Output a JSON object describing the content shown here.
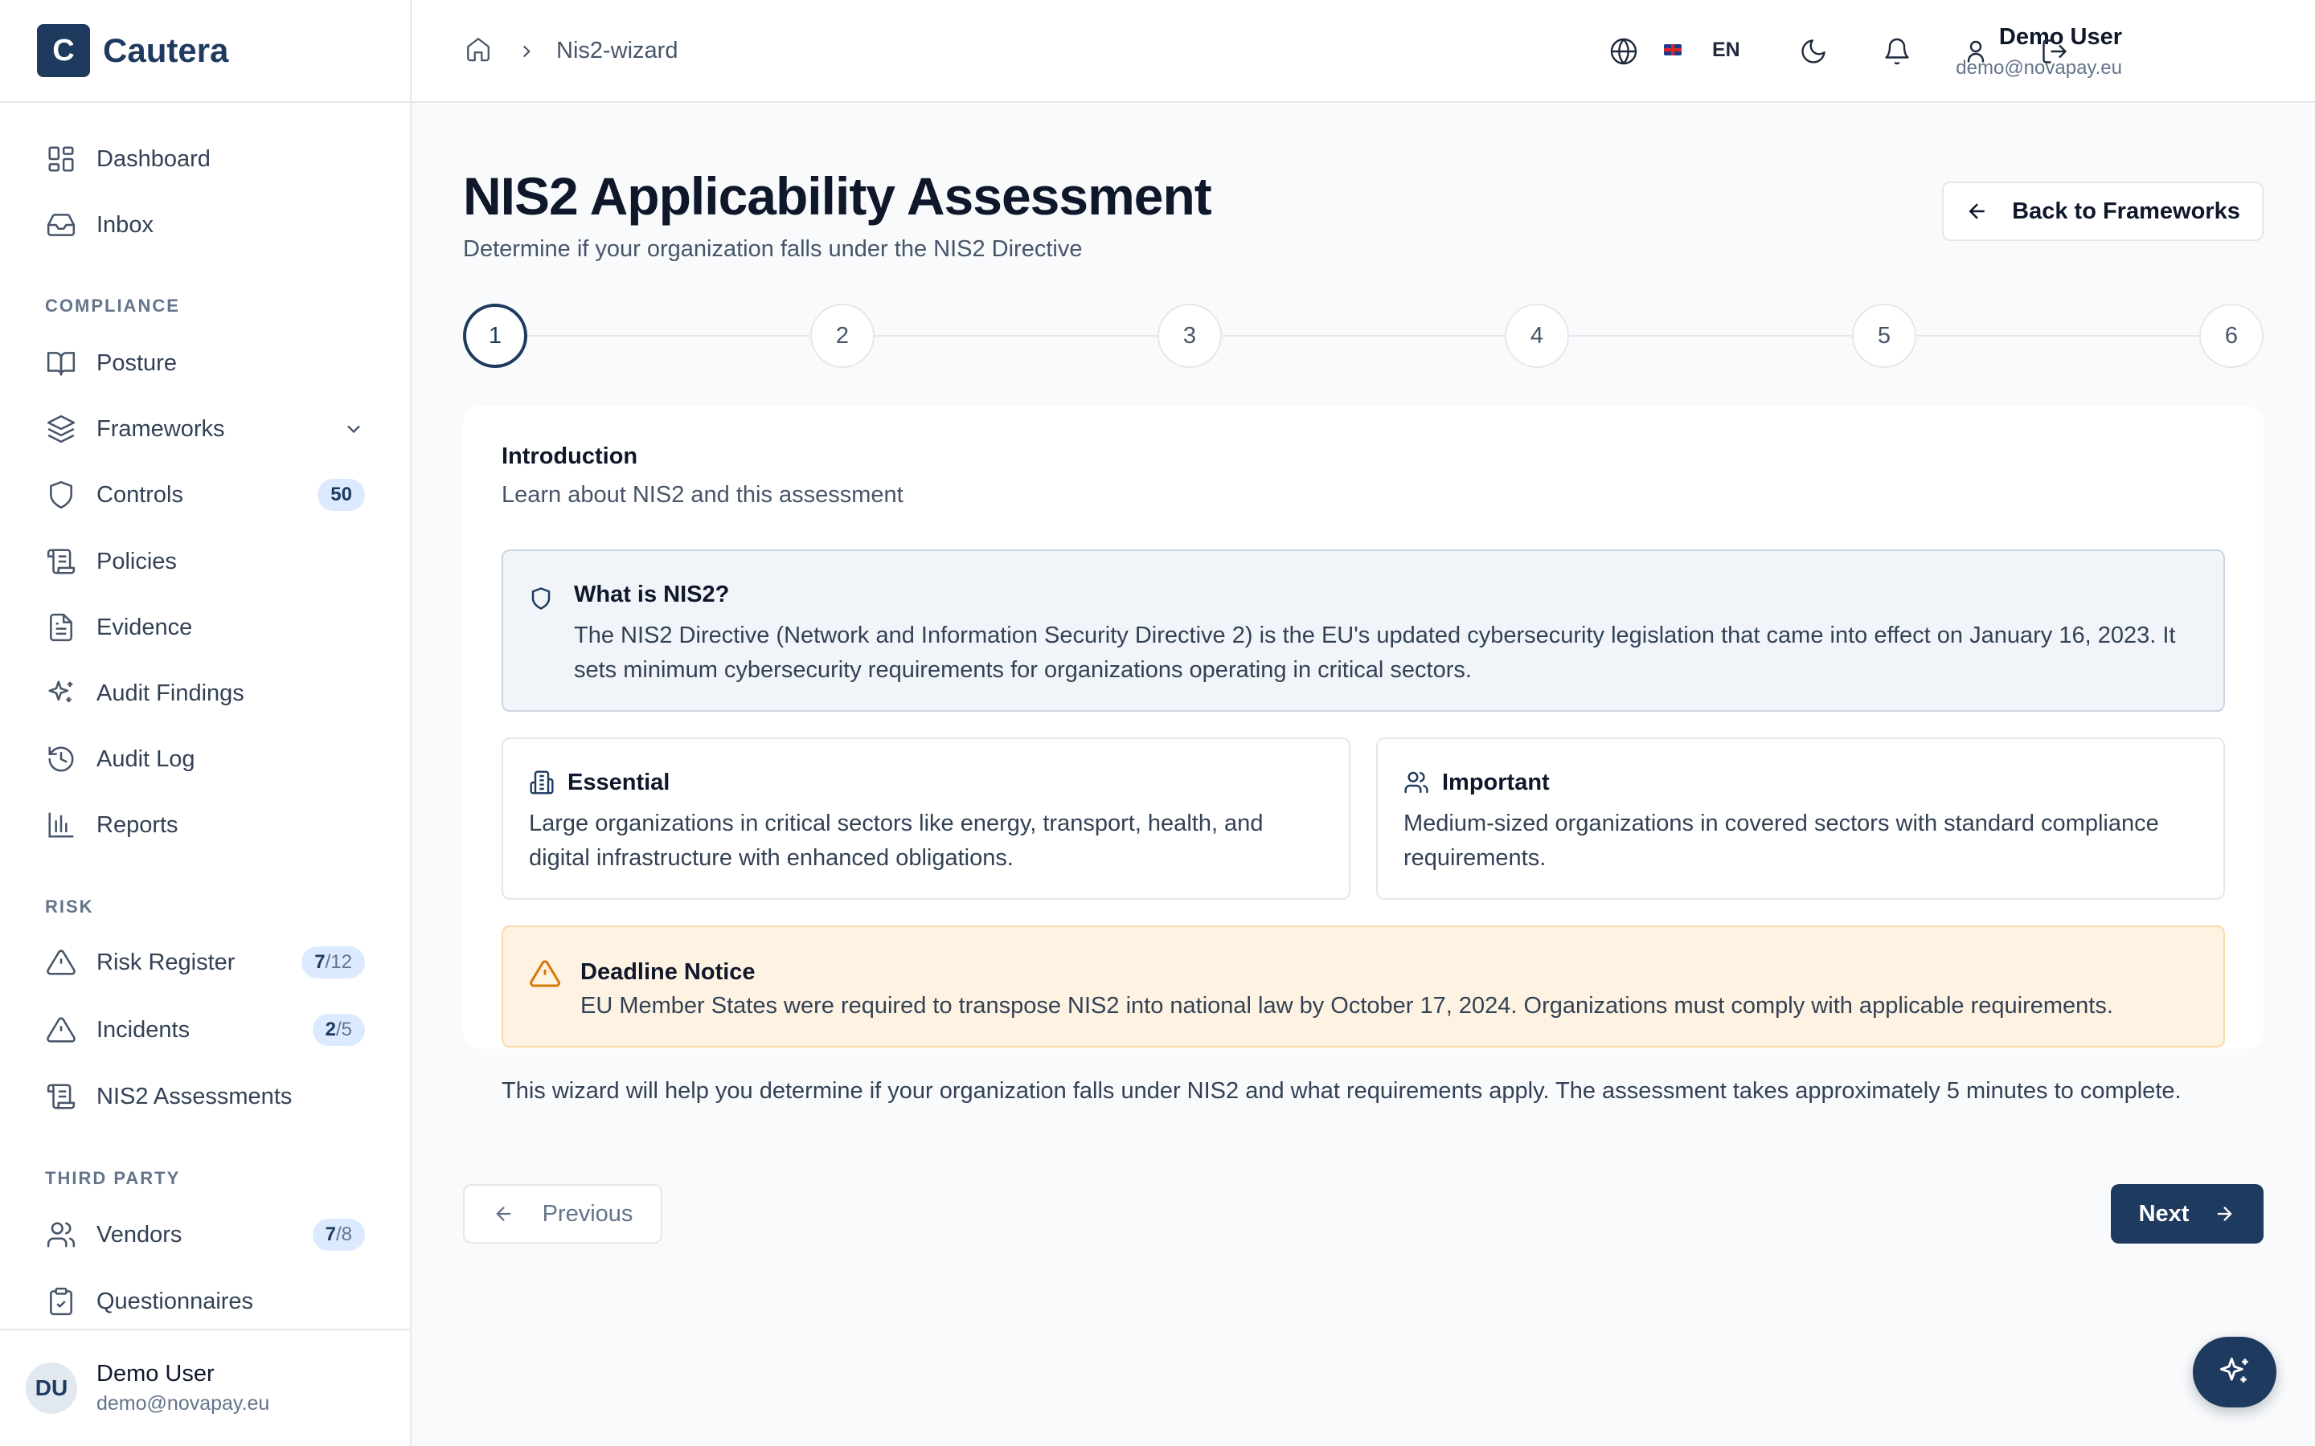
{
  "brand": {
    "logo_letter": "C",
    "name": "Cautera"
  },
  "sidebar": {
    "items": [
      {
        "label": "Dashboard",
        "icon": "grid-icon"
      },
      {
        "label": "Inbox",
        "icon": "inbox-icon"
      }
    ],
    "compliance_title": "COMPLIANCE",
    "compliance": [
      {
        "label": "Posture",
        "icon": "book-open-icon"
      },
      {
        "label": "Frameworks",
        "icon": "layers-icon"
      },
      {
        "label": "Controls",
        "icon": "shield-icon",
        "badge": "50"
      },
      {
        "label": "Policies",
        "icon": "scroll-icon"
      },
      {
        "label": "Evidence",
        "icon": "file-text-icon"
      },
      {
        "label": "Audit Findings",
        "icon": "sparkles-icon"
      },
      {
        "label": "Audit Log",
        "icon": "history-icon"
      },
      {
        "label": "Reports",
        "icon": "bar-chart-icon"
      }
    ],
    "risk_title": "RISK",
    "risk": [
      {
        "label": "Risk Register",
        "icon": "alert-triangle-icon",
        "badge_a": "7",
        "badge_b": "/12"
      },
      {
        "label": "Incidents",
        "icon": "alert-triangle-icon",
        "badge_a": "2",
        "badge_b": "/5"
      },
      {
        "label": "NIS2 Assessments",
        "icon": "scroll-icon"
      }
    ],
    "third_party_title": "THIRD PARTY",
    "third_party": [
      {
        "label": "Vendors",
        "icon": "users-icon",
        "badge_a": "7",
        "badge_b": "/8"
      },
      {
        "label": "Questionnaires",
        "icon": "clipboard-check-icon"
      }
    ],
    "user": {
      "initials": "DU",
      "name": "Demo User",
      "email": "demo@novapay.eu"
    }
  },
  "topbar": {
    "breadcrumb": "Nis2-wizard",
    "language": "EN",
    "user_name": "Demo User",
    "user_email": "demo@novapay.eu"
  },
  "page": {
    "title": "NIS2 Applicability Assessment",
    "subtitle": "Determine if your organization falls under the NIS2 Directive",
    "back_label": "Back to Frameworks"
  },
  "steps": [
    "1",
    "2",
    "3",
    "4",
    "5",
    "6"
  ],
  "current_step": 1,
  "card": {
    "title": "Introduction",
    "subtitle": "Learn about NIS2 and this assessment",
    "info_title": "What is NIS2?",
    "info_text": "The NIS2 Directive (Network and Information Security Directive 2) is the EU's updated cybersecurity legislation that came into effect on January 16, 2023. It sets minimum cybersecurity requirements for organizations operating in critical sectors.",
    "essential_title": "Essential",
    "essential_text": "Large organizations in critical sectors like energy, transport, health, and digital infrastructure with enhanced obligations.",
    "important_title": "Important",
    "important_text": "Medium-sized organizations in covered sectors with standard compliance requirements.",
    "notice_title": "Deadline Notice",
    "notice_text": "EU Member States were required to transpose NIS2 into national law by October 17, 2024. Organizations must comply with applicable requirements.",
    "footnote": "This wizard will help you determine if your organization falls under NIS2 and what requirements apply. The assessment takes approximately 5 minutes to complete."
  },
  "nav": {
    "previous": "Previous",
    "next": "Next"
  },
  "colors": {
    "primary": "#1e3a5f",
    "warning": "#d97706",
    "warning_bg": "#fef3e2"
  }
}
